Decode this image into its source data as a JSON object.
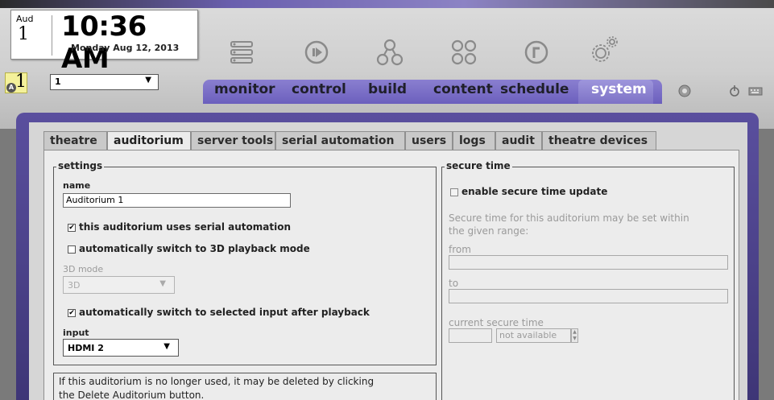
{
  "clock": {
    "month": "Aud",
    "day": "1",
    "time": "10:36 AM",
    "date": "Monday Aug 12, 2013"
  },
  "screen": {
    "badge": "1",
    "badge_dot": "A",
    "selected": "1"
  },
  "nav_icons": [
    "monitor-icon",
    "control-icon",
    "build-icon",
    "content-icon",
    "schedule-icon",
    "system-icon"
  ],
  "main_nav": {
    "tabs": [
      "monitor",
      "control",
      "build",
      "content",
      "schedule",
      "system"
    ],
    "active": "system"
  },
  "sub_tabs": {
    "items": [
      "theatre",
      "auditorium",
      "server tools",
      "serial automation",
      "users",
      "logs",
      "audit",
      "theatre devices"
    ],
    "active": "auditorium"
  },
  "settings": {
    "legend": "settings",
    "name_label": "name",
    "name_value": "Auditorium 1",
    "serial_automation_label": "this auditorium uses serial automation",
    "serial_automation_checked": true,
    "auto_3d_label": "automatically switch to 3D playback mode",
    "auto_3d_checked": false,
    "mode_3d_label": "3D mode",
    "mode_3d_value": "3D",
    "auto_input_label": "automatically switch to selected input after playback",
    "auto_input_checked": true,
    "input_label": "input",
    "input_value": "HDMI 2"
  },
  "delete_note": {
    "line1": "If this auditorium is no longer used, it may be deleted by clicking",
    "line2": "the Delete Auditorium button."
  },
  "secure_time": {
    "legend": "secure time",
    "enable_label": "enable secure time update",
    "enable_checked": false,
    "desc_line1": "Secure time for this auditorium may be set within",
    "desc_line2": "the given range:",
    "from_label": "from",
    "to_label": "to",
    "current_label": "current secure time",
    "current_value": "not available"
  },
  "colors": {
    "nav_purple": "#6b5fbd",
    "frame_purple": "#4a4088",
    "badge_yellow": "#f4f19a"
  }
}
